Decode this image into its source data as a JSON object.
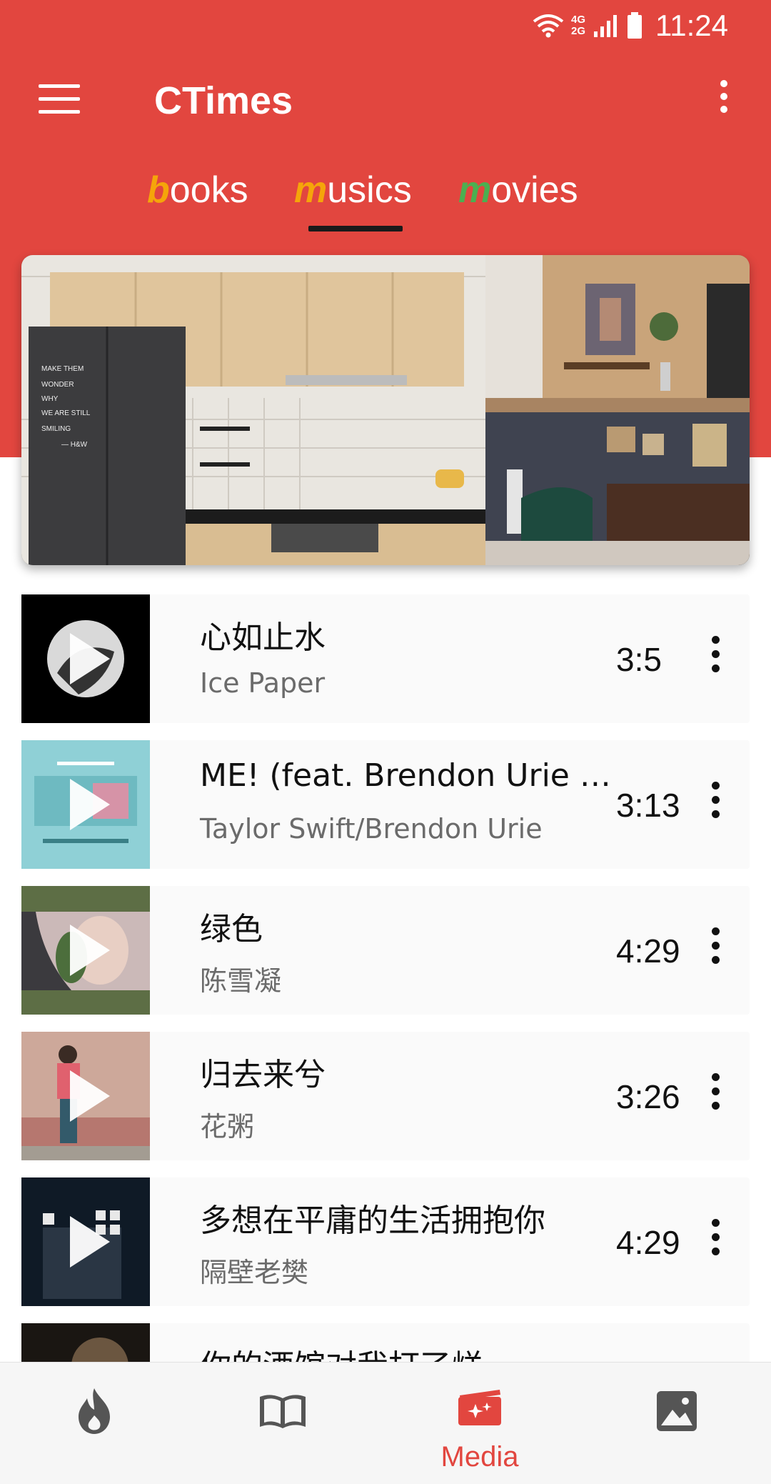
{
  "status_bar": {
    "time": "11:24",
    "net_top": "4G",
    "net_bottom": "2G",
    "icons": [
      "wifi-icon",
      "signal-icon",
      "battery-icon"
    ]
  },
  "app_bar": {
    "title": "CTimes",
    "menu_icon": "menu-icon",
    "overflow_icon": "more-vert-icon"
  },
  "tabs": [
    {
      "first": "b",
      "rest": "ooks",
      "accent": "#f5a50a"
    },
    {
      "first": "m",
      "rest": "usics",
      "accent": "#f5a50a"
    },
    {
      "first": "m",
      "rest": "ovies",
      "accent": "#4caf50"
    }
  ],
  "active_tab": "musics",
  "songs": [
    {
      "title": "心如止水",
      "artist": "Ice Paper",
      "duration": "3:5"
    },
    {
      "title": "ME! (feat. Brendon Urie of Panic! At The Disco)",
      "artist": "Taylor Swift/Brendon Urie",
      "duration": "3:13"
    },
    {
      "title": "绿色",
      "artist": "陈雪凝",
      "duration": "4:29"
    },
    {
      "title": "归去来兮",
      "artist": "花粥",
      "duration": "3:26"
    },
    {
      "title": "多想在平庸的生活拥抱你",
      "artist": "隔壁老樊",
      "duration": "4:29"
    },
    {
      "title": "你的酒馆对我打了烊",
      "artist": "",
      "duration": ""
    }
  ],
  "bottom_nav": [
    {
      "icon": "flame-icon",
      "label": ""
    },
    {
      "icon": "book-icon",
      "label": ""
    },
    {
      "icon": "media-icon",
      "label": "Media"
    },
    {
      "icon": "image-icon",
      "label": ""
    }
  ],
  "colors": {
    "primary": "#e2463f",
    "active_text": "#e2463f"
  }
}
